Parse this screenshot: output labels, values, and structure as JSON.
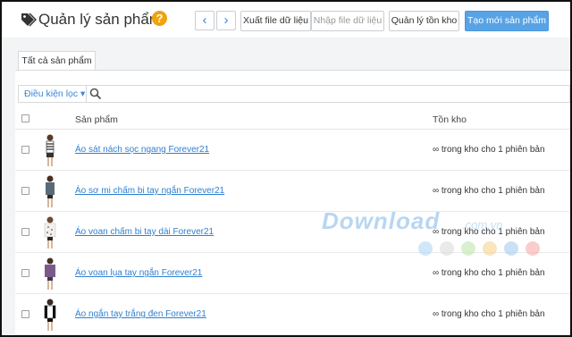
{
  "header": {
    "title": "Quản lý sản phẩm",
    "help": "?",
    "prev": "‹",
    "next": "›",
    "export_label": "Xuất file dữ liệu",
    "import_label": "Nhập file dữ liệu",
    "inventory_label": "Quản lý tồn kho",
    "create_label": "Tạo mới sản phẩm"
  },
  "tabs": [
    {
      "label": "Tất cả sản phẩm"
    }
  ],
  "filter": {
    "label": "Điều kiện lọc ▾"
  },
  "table": {
    "headers": {
      "product": "Sản phẩm",
      "stock": "Tồn kho"
    },
    "rows": [
      {
        "name": "Áo sát nách sọc ngang Forever21",
        "stock": "∞ trong kho cho 1 phiên bản"
      },
      {
        "name": "Áo sơ mi chấm bi tay ngắn Forever21",
        "stock": "∞ trong kho cho 1 phiên bản"
      },
      {
        "name": "Áo voan chấm bi tay dài Forever21",
        "stock": "∞ trong kho cho 1 phiên bản"
      },
      {
        "name": "Áo voan lụa tay ngắn Forever21",
        "stock": "∞ trong kho cho 1 phiên bản"
      },
      {
        "name": "Áo ngắn tay trắng đen Forever21",
        "stock": "∞ trong kho cho 1 phiên bản"
      }
    ]
  },
  "watermark": {
    "text": "Download",
    "suffix": ".com.vn"
  },
  "colors": {
    "accent": "#2f80d1",
    "primary_button": "#58a3e6",
    "help_icon": "#f0a30a",
    "watermark_dots": [
      "#a8d4f2",
      "#d9d9d9",
      "#b9e3a6",
      "#f6cf86",
      "#9ec8ec",
      "#f5a3a3"
    ]
  }
}
